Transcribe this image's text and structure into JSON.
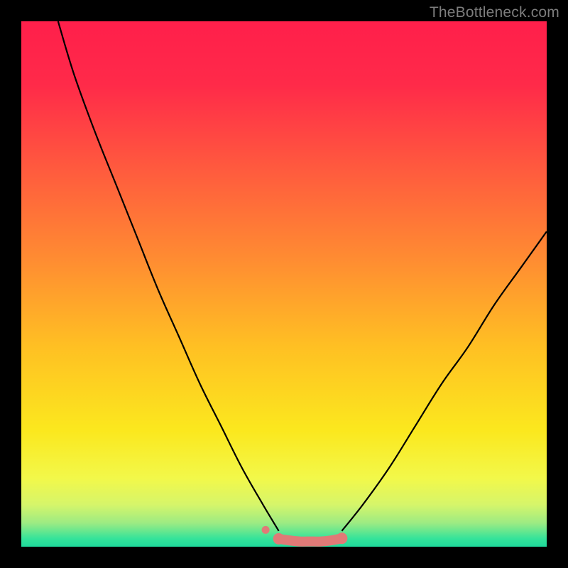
{
  "watermark": {
    "text": "TheBottleneck.com"
  },
  "colors": {
    "gradient_stops": [
      {
        "offset": 0.0,
        "color": "#ff1f4b"
      },
      {
        "offset": 0.12,
        "color": "#ff2a49"
      },
      {
        "offset": 0.28,
        "color": "#ff5a3e"
      },
      {
        "offset": 0.45,
        "color": "#ff8b32"
      },
      {
        "offset": 0.62,
        "color": "#ffc023"
      },
      {
        "offset": 0.78,
        "color": "#fbe81e"
      },
      {
        "offset": 0.87,
        "color": "#f2f84a"
      },
      {
        "offset": 0.92,
        "color": "#d6f56a"
      },
      {
        "offset": 0.955,
        "color": "#9ceb83"
      },
      {
        "offset": 0.985,
        "color": "#34e39a"
      },
      {
        "offset": 1.0,
        "color": "#1fd99b"
      }
    ],
    "curve_stroke": "#000000",
    "marker_fill": "#e07a77",
    "marker_stroke": "#d86c69"
  },
  "chart_data": {
    "type": "line",
    "title": "",
    "xlabel": "",
    "ylabel": "",
    "xlim": [
      0,
      100
    ],
    "ylim": [
      0,
      100
    ],
    "grid": false,
    "legend": false,
    "note": "Bottleneck curve. Y = bottleneck % (0 at bottom, ~100 at top). X = relative component balance. Values estimated from pixel positions; no axis ticks or labels are rendered in the image.",
    "series": [
      {
        "name": "left-branch",
        "x": [
          7,
          10,
          14,
          18,
          22,
          26,
          30,
          34,
          38,
          42,
          46,
          49
        ],
        "y": [
          100,
          90,
          79,
          69,
          59,
          49,
          40,
          31,
          23,
          15,
          8,
          3
        ]
      },
      {
        "name": "right-branch",
        "x": [
          61,
          65,
          70,
          75,
          80,
          85,
          90,
          95,
          100
        ],
        "y": [
          3,
          8,
          15,
          23,
          31,
          38,
          46,
          53,
          60
        ]
      },
      {
        "name": "bottom-flat-markers",
        "x": [
          49,
          51,
          53,
          55,
          57,
          59,
          61
        ],
        "y": [
          1.5,
          1.2,
          1.0,
          1.0,
          1.0,
          1.2,
          1.6
        ]
      },
      {
        "name": "isolated-marker",
        "x": [
          46.5
        ],
        "y": [
          3.2
        ]
      }
    ]
  }
}
